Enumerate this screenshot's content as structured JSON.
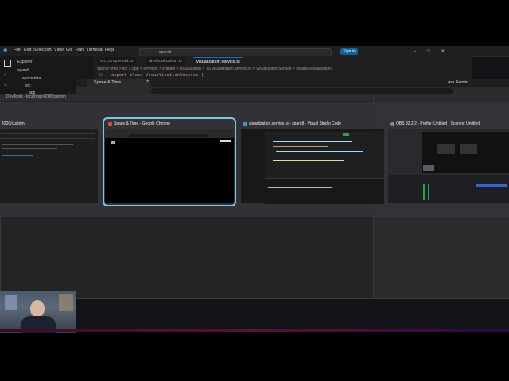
{
  "vscode": {
    "menu": [
      "File",
      "Edit",
      "Selection",
      "View",
      "Go",
      "Run",
      "Terminal",
      "Help"
    ],
    "search_text": "spandt",
    "sign_in": "Sign in",
    "tabs": [
      "viz.component.ts",
      "ai-visualization.ts",
      "visualization.service.ts"
    ],
    "active_tab_index": 2,
    "breadcrumb": "spacer-time > src > app > services > entities > visualization > TS visualization.service.ts > VisualizationService > createAVisualization",
    "code_line_number": "19",
    "code_line": "export class VisualizationService {",
    "sidebar_title": "Explorer",
    "sidebar_items": [
      "spandt",
      "space-time",
      "src",
      "app"
    ]
  },
  "chrome": {
    "tab_title": "Space & Time",
    "ask_gemini": "Ask Gemini"
  },
  "devtools": {
    "title": "DevTools - localhost:4200/custom"
  },
  "switcher": {
    "items": [
      {
        "title": "4200/custom",
        "icon_color": "#4a90d9"
      },
      {
        "title": "Space & Time - Google Chrome",
        "icon_color": "#e8453c"
      },
      {
        "title": "visualization.service.ts - spandt - Visual Studio Code",
        "icon_color": "#3a96dd"
      },
      {
        "title": "OBS 32.2.2 - Profile: Untitled - Scenes: Untitled",
        "icon_color": "#8e8e8e"
      }
    ],
    "selected_index": 1
  },
  "colors": {
    "selection_border": "#76c8e8",
    "vscode_accent": "#0078d4"
  }
}
